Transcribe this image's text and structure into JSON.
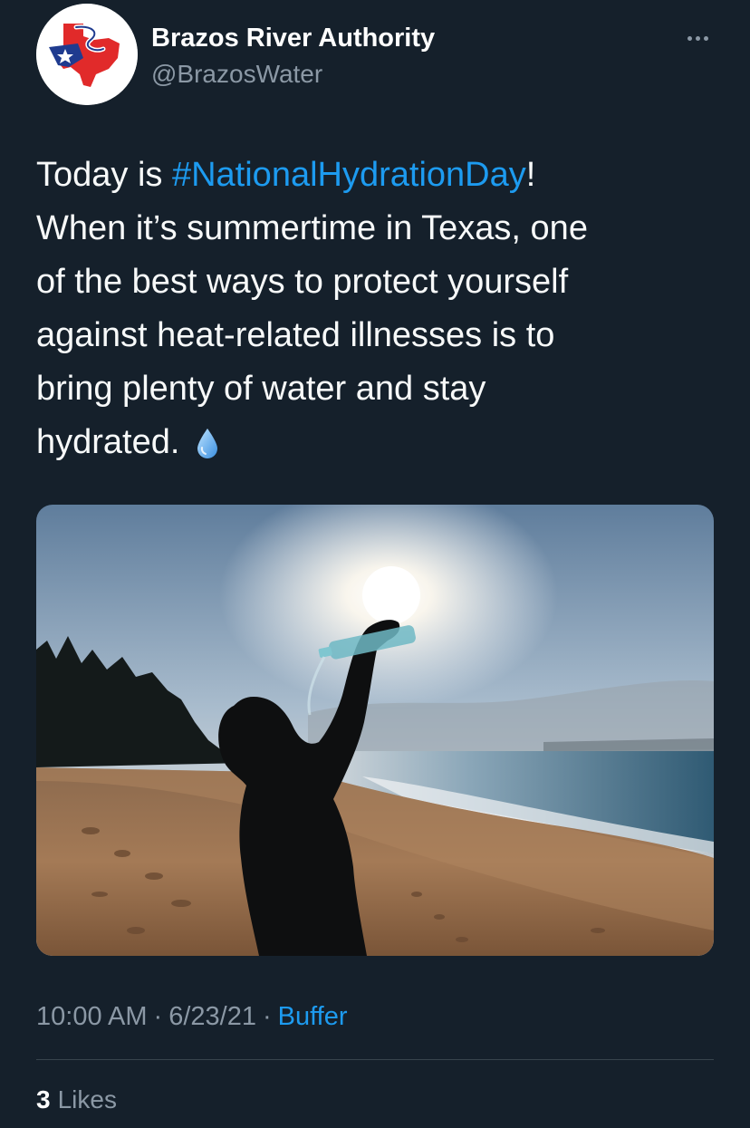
{
  "account": {
    "name": "Brazos River Authority",
    "handle": "@BrazosWater"
  },
  "tweet": {
    "text_lines": [
      {
        "before": "Today is ",
        "hashtag": "#NationalHydrationDay",
        "after": "!"
      },
      "When it’s summertime in Texas, one",
      "of the best ways to protect yourself",
      "against heat-related illnesses is to",
      "bring plenty of water and stay",
      "hydrated."
    ],
    "emoji": "water-droplet-icon"
  },
  "meta": {
    "time": "10:00 AM",
    "separator": "·",
    "date": "6/23/21",
    "source": "Buffer"
  },
  "stats": {
    "likes_count": "3",
    "likes_label": "Likes"
  },
  "colors": {
    "background": "#15202b",
    "link": "#1d9bf0",
    "secondary_text": "#8b98a5",
    "divider": "#38444d"
  }
}
